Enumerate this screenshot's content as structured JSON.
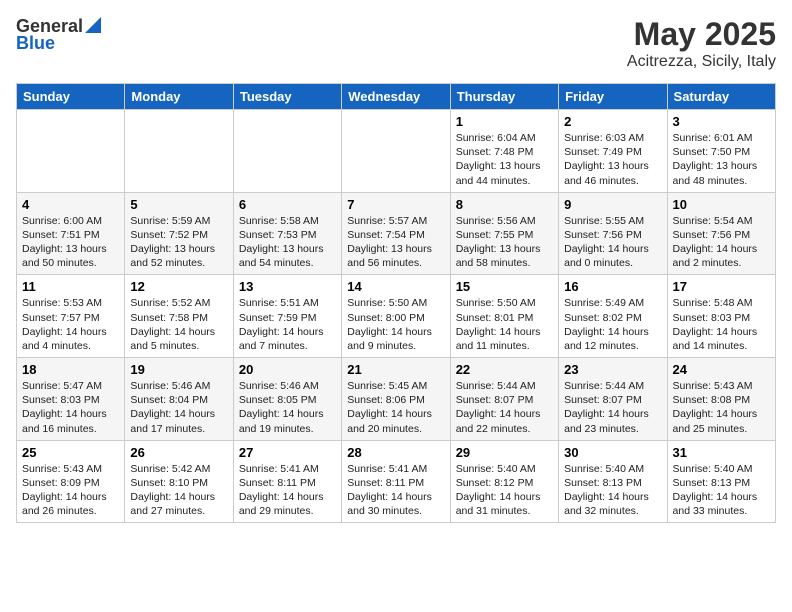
{
  "header": {
    "logo_general": "General",
    "logo_blue": "Blue",
    "title": "May 2025",
    "location": "Acitrezza, Sicily, Italy"
  },
  "weekdays": [
    "Sunday",
    "Monday",
    "Tuesday",
    "Wednesday",
    "Thursday",
    "Friday",
    "Saturday"
  ],
  "weeks": [
    [
      {
        "day": "",
        "info": ""
      },
      {
        "day": "",
        "info": ""
      },
      {
        "day": "",
        "info": ""
      },
      {
        "day": "",
        "info": ""
      },
      {
        "day": "1",
        "info": "Sunrise: 6:04 AM\nSunset: 7:48 PM\nDaylight: 13 hours\nand 44 minutes."
      },
      {
        "day": "2",
        "info": "Sunrise: 6:03 AM\nSunset: 7:49 PM\nDaylight: 13 hours\nand 46 minutes."
      },
      {
        "day": "3",
        "info": "Sunrise: 6:01 AM\nSunset: 7:50 PM\nDaylight: 13 hours\nand 48 minutes."
      }
    ],
    [
      {
        "day": "4",
        "info": "Sunrise: 6:00 AM\nSunset: 7:51 PM\nDaylight: 13 hours\nand 50 minutes."
      },
      {
        "day": "5",
        "info": "Sunrise: 5:59 AM\nSunset: 7:52 PM\nDaylight: 13 hours\nand 52 minutes."
      },
      {
        "day": "6",
        "info": "Sunrise: 5:58 AM\nSunset: 7:53 PM\nDaylight: 13 hours\nand 54 minutes."
      },
      {
        "day": "7",
        "info": "Sunrise: 5:57 AM\nSunset: 7:54 PM\nDaylight: 13 hours\nand 56 minutes."
      },
      {
        "day": "8",
        "info": "Sunrise: 5:56 AM\nSunset: 7:55 PM\nDaylight: 13 hours\nand 58 minutes."
      },
      {
        "day": "9",
        "info": "Sunrise: 5:55 AM\nSunset: 7:56 PM\nDaylight: 14 hours\nand 0 minutes."
      },
      {
        "day": "10",
        "info": "Sunrise: 5:54 AM\nSunset: 7:56 PM\nDaylight: 14 hours\nand 2 minutes."
      }
    ],
    [
      {
        "day": "11",
        "info": "Sunrise: 5:53 AM\nSunset: 7:57 PM\nDaylight: 14 hours\nand 4 minutes."
      },
      {
        "day": "12",
        "info": "Sunrise: 5:52 AM\nSunset: 7:58 PM\nDaylight: 14 hours\nand 5 minutes."
      },
      {
        "day": "13",
        "info": "Sunrise: 5:51 AM\nSunset: 7:59 PM\nDaylight: 14 hours\nand 7 minutes."
      },
      {
        "day": "14",
        "info": "Sunrise: 5:50 AM\nSunset: 8:00 PM\nDaylight: 14 hours\nand 9 minutes."
      },
      {
        "day": "15",
        "info": "Sunrise: 5:50 AM\nSunset: 8:01 PM\nDaylight: 14 hours\nand 11 minutes."
      },
      {
        "day": "16",
        "info": "Sunrise: 5:49 AM\nSunset: 8:02 PM\nDaylight: 14 hours\nand 12 minutes."
      },
      {
        "day": "17",
        "info": "Sunrise: 5:48 AM\nSunset: 8:03 PM\nDaylight: 14 hours\nand 14 minutes."
      }
    ],
    [
      {
        "day": "18",
        "info": "Sunrise: 5:47 AM\nSunset: 8:03 PM\nDaylight: 14 hours\nand 16 minutes."
      },
      {
        "day": "19",
        "info": "Sunrise: 5:46 AM\nSunset: 8:04 PM\nDaylight: 14 hours\nand 17 minutes."
      },
      {
        "day": "20",
        "info": "Sunrise: 5:46 AM\nSunset: 8:05 PM\nDaylight: 14 hours\nand 19 minutes."
      },
      {
        "day": "21",
        "info": "Sunrise: 5:45 AM\nSunset: 8:06 PM\nDaylight: 14 hours\nand 20 minutes."
      },
      {
        "day": "22",
        "info": "Sunrise: 5:44 AM\nSunset: 8:07 PM\nDaylight: 14 hours\nand 22 minutes."
      },
      {
        "day": "23",
        "info": "Sunrise: 5:44 AM\nSunset: 8:07 PM\nDaylight: 14 hours\nand 23 minutes."
      },
      {
        "day": "24",
        "info": "Sunrise: 5:43 AM\nSunset: 8:08 PM\nDaylight: 14 hours\nand 25 minutes."
      }
    ],
    [
      {
        "day": "25",
        "info": "Sunrise: 5:43 AM\nSunset: 8:09 PM\nDaylight: 14 hours\nand 26 minutes."
      },
      {
        "day": "26",
        "info": "Sunrise: 5:42 AM\nSunset: 8:10 PM\nDaylight: 14 hours\nand 27 minutes."
      },
      {
        "day": "27",
        "info": "Sunrise: 5:41 AM\nSunset: 8:11 PM\nDaylight: 14 hours\nand 29 minutes."
      },
      {
        "day": "28",
        "info": "Sunrise: 5:41 AM\nSunset: 8:11 PM\nDaylight: 14 hours\nand 30 minutes."
      },
      {
        "day": "29",
        "info": "Sunrise: 5:40 AM\nSunset: 8:12 PM\nDaylight: 14 hours\nand 31 minutes."
      },
      {
        "day": "30",
        "info": "Sunrise: 5:40 AM\nSunset: 8:13 PM\nDaylight: 14 hours\nand 32 minutes."
      },
      {
        "day": "31",
        "info": "Sunrise: 5:40 AM\nSunset: 8:13 PM\nDaylight: 14 hours\nand 33 minutes."
      }
    ]
  ]
}
